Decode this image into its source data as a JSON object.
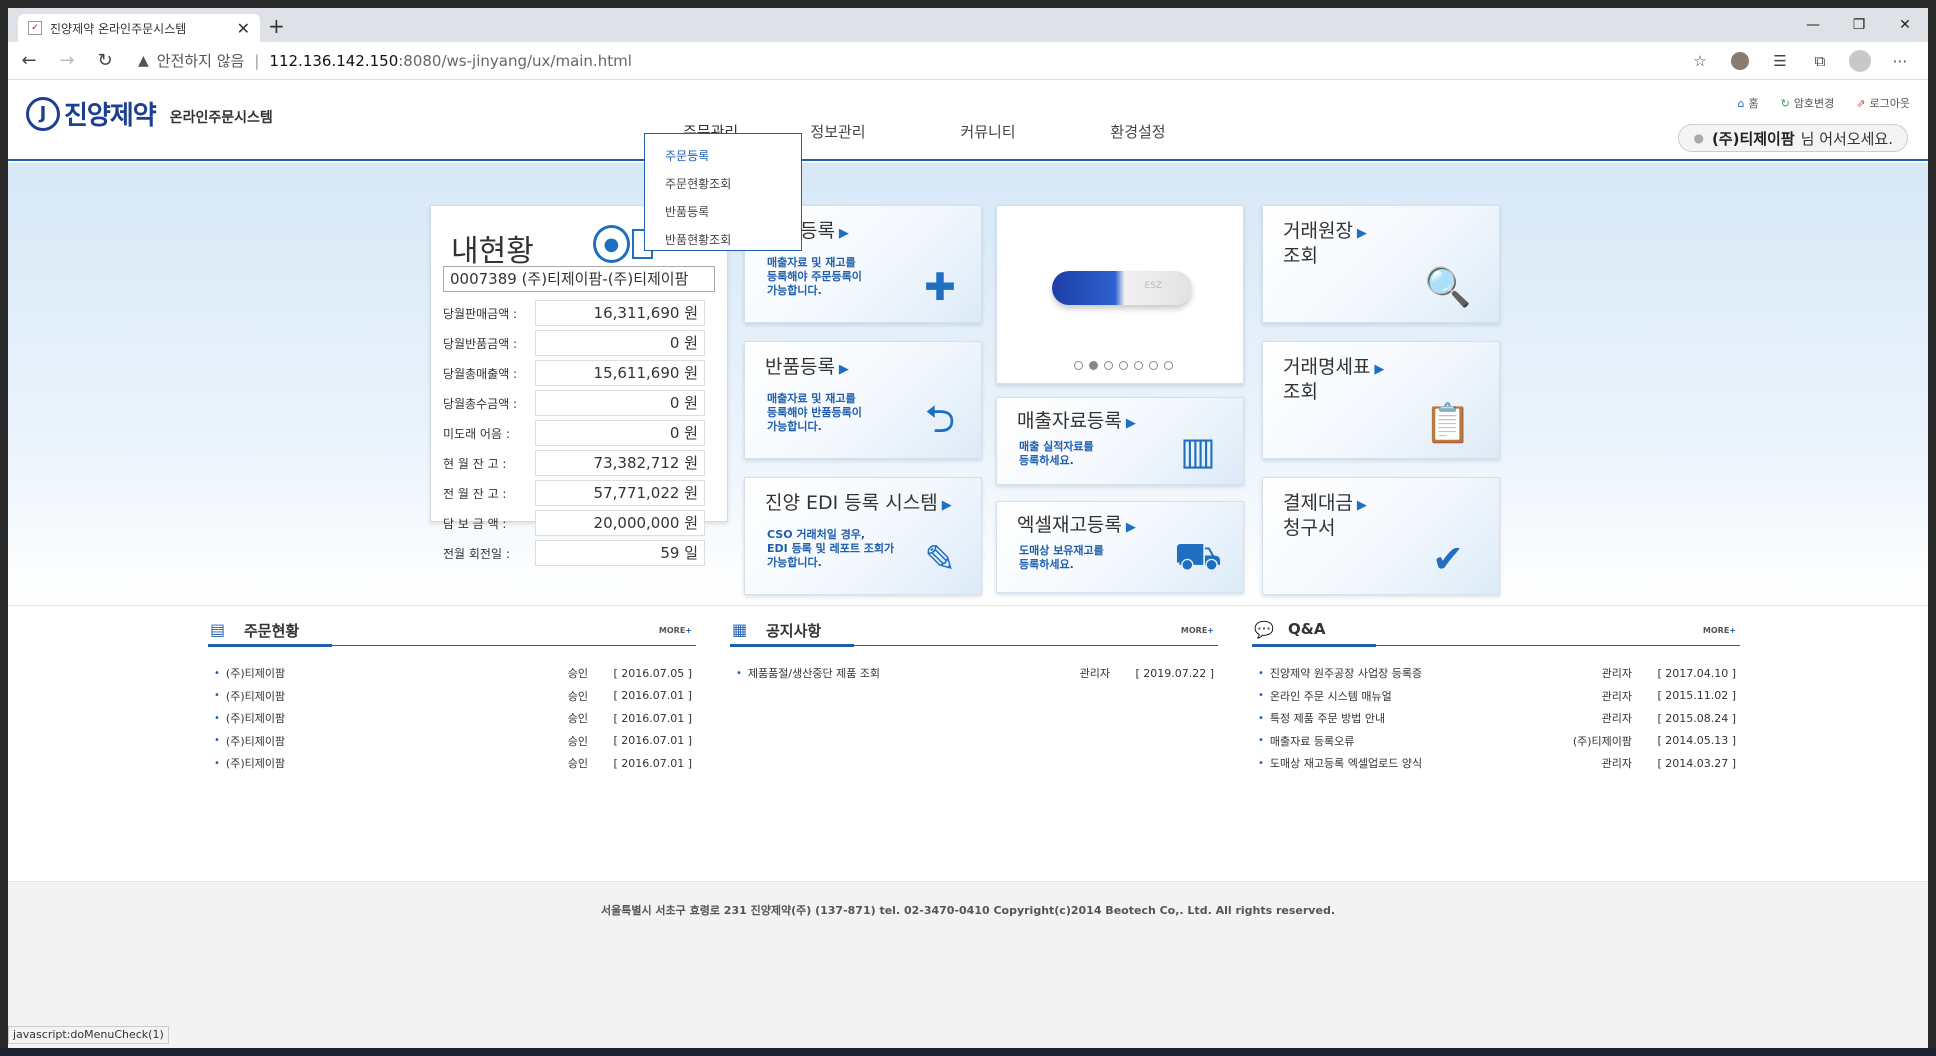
{
  "browser": {
    "tab_title": "진양제약 온라인주문시스템",
    "tab_close": "✕",
    "new_tab": "+",
    "security_label": "안전하지 않음",
    "url_host": "112.136.142.150",
    "url_path": ":8080/ws-jinyang/ux/main.html",
    "status_text": "javascript:doMenuCheck(1)"
  },
  "site": {
    "logo_name": "진양제약",
    "logo_sub": "온라인주문시스템",
    "util": {
      "home": "홈",
      "password": "암호변경",
      "logout": "로그아웃"
    },
    "welcome_user": "(주)티제이팜",
    "welcome_suffix": "님 어서오세요.",
    "nav": [
      "주문관리",
      "정보관리",
      "커뮤니티",
      "환경설정"
    ],
    "submenu": [
      "주문등록",
      "주문현황조회",
      "반품등록",
      "반품현황조회"
    ]
  },
  "status": {
    "title": "내현황",
    "account": "0007389  (주)티제이팜-(주)티제이팜",
    "rows": [
      {
        "label": "당월판매금액 :",
        "value": "16,311,690 원"
      },
      {
        "label": "당월반품금액 :",
        "value": "0 원"
      },
      {
        "label": "당월총매출액 :",
        "value": "15,611,690 원"
      },
      {
        "label": "당월총수금액 :",
        "value": "0 원"
      },
      {
        "label": "미도래  어음 :",
        "value": "0 원"
      },
      {
        "label": "현 월  잔 고 :",
        "value": "73,382,712 원"
      },
      {
        "label": "전 월  잔 고 :",
        "value": "57,771,022 원"
      },
      {
        "label": "담 보  금 액 :",
        "value": "20,000,000 원"
      },
      {
        "label": "전월  회전일 :",
        "value": "59 일"
      }
    ]
  },
  "tiles": {
    "order": {
      "title": "주문등록",
      "desc": [
        "매출자료 및 재고를",
        "등록해야 주문등록이",
        "가능합니다."
      ]
    },
    "return": {
      "title": "반품등록",
      "desc": [
        "매출자료 및 재고를",
        "등록해야 반품등록이",
        "가능합니다."
      ]
    },
    "edi": {
      "title": "진양 EDI 등록 시스템",
      "desc": [
        "CSO 거래처일 경우,",
        "EDI 등록 및 레포트 조회가",
        "가능합니다."
      ]
    },
    "sales": {
      "title": "매출자료등록",
      "desc": [
        "매출 실적자료를",
        "등록하세요."
      ]
    },
    "excel": {
      "title": "엑셀재고등록",
      "desc": [
        "도매상 보유재고를",
        "등록하세요."
      ]
    },
    "ledger": {
      "title_1": "거래원장",
      "title_2": "조회"
    },
    "statement": {
      "title_1": "거래명세표",
      "title_2": "조회"
    },
    "invoice": {
      "title_1": "결제대금",
      "title_2": "청구서"
    },
    "pill_text": "ESZ",
    "slide_count": 7,
    "slide_active": 1
  },
  "boards": {
    "orders": {
      "title": "주문현황",
      "more": "MORE",
      "items": [
        {
          "title": "(주)티제이팜",
          "writer": "승인",
          "date": "[ 2016.07.05 ]"
        },
        {
          "title": "(주)티제이팜",
          "writer": "승인",
          "date": "[ 2016.07.01 ]"
        },
        {
          "title": "(주)티제이팜",
          "writer": "승인",
          "date": "[ 2016.07.01 ]"
        },
        {
          "title": "(주)티제이팜",
          "writer": "승인",
          "date": "[ 2016.07.01 ]"
        },
        {
          "title": "(주)티제이팜",
          "writer": "승인",
          "date": "[ 2016.07.01 ]"
        }
      ]
    },
    "notice": {
      "title": "공지사항",
      "more": "MORE",
      "items": [
        {
          "title": "제품품절/생산중단 제품 조회",
          "writer": "관리자",
          "date": "[ 2019.07.22 ]"
        }
      ]
    },
    "qna": {
      "title": "Q&A",
      "more": "MORE",
      "items": [
        {
          "title": "진양제약 원주공장 사업장 등록증",
          "writer": "관리자",
          "date": "[ 2017.04.10 ]"
        },
        {
          "title": "온라인 주문 시스템 매뉴얼",
          "writer": "관리자",
          "date": "[ 2015.11.02 ]"
        },
        {
          "title": "특정 제품 주문 방법 안내",
          "writer": "관리자",
          "date": "[ 2015.08.24 ]"
        },
        {
          "title": "매출자료 등록오류",
          "writer": "(주)티제이팜",
          "date": "[ 2014.05.13 ]"
        },
        {
          "title": "도매상 재고등록 엑셀업로드 양식",
          "writer": "관리자",
          "date": "[ 2014.03.27 ]"
        }
      ]
    }
  },
  "footer": "서울특별시 서초구 효령로 231 진양제약(주) (137-871)  tel. 02-3470-0410  Copyright(c)2014 Beotech Co,. Ltd. All rights reserved."
}
